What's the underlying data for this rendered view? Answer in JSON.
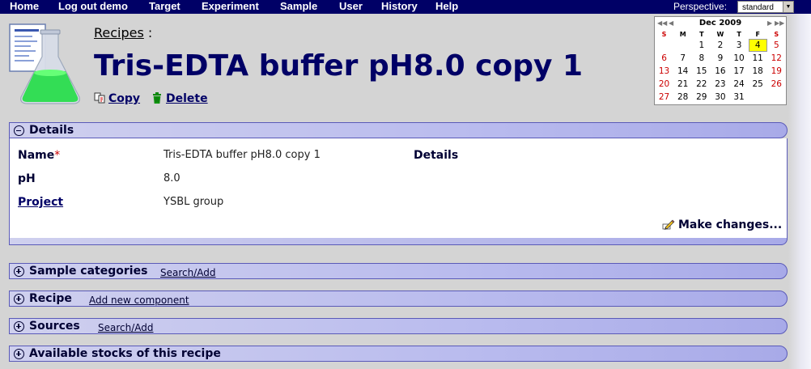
{
  "nav": {
    "items": [
      "Home",
      "Log out demo",
      "Target",
      "Experiment",
      "Sample",
      "User",
      "History",
      "Help"
    ],
    "perspective_label": "Perspective:",
    "perspective_value": "standard"
  },
  "header": {
    "breadcrumb": "Recipes",
    "breadcrumb_sep": ":",
    "title": "Tris-EDTA buffer pH8.0 copy 1",
    "copy_label": "Copy",
    "delete_label": "Delete"
  },
  "calendar": {
    "prev_year": "◀◀",
    "prev_month": "◀",
    "next_month": "▶",
    "next_year": "▶▶",
    "month": "Dec 2009",
    "dow": [
      "S",
      "M",
      "T",
      "W",
      "T",
      "F",
      "S"
    ],
    "weeks": [
      [
        "",
        "",
        "1",
        "2",
        "3",
        "4",
        "5"
      ],
      [
        "6",
        "7",
        "8",
        "9",
        "10",
        "11",
        "12"
      ],
      [
        "13",
        "14",
        "15",
        "16",
        "17",
        "18",
        "19"
      ],
      [
        "20",
        "21",
        "22",
        "23",
        "24",
        "25",
        "26"
      ],
      [
        "27",
        "28",
        "29",
        "30",
        "31",
        "",
        ""
      ]
    ],
    "today": "4"
  },
  "details": {
    "title": "Details",
    "name_label": "Name",
    "required_mark": "*",
    "name_value": "Tris-EDTA buffer pH8.0 copy 1",
    "ph_label": "pH",
    "ph_value": "8.0",
    "project_label": "Project",
    "project_value": "YSBL group",
    "details_label": "Details",
    "make_changes": "Make changes..."
  },
  "sections": [
    {
      "title": "Sample categories",
      "link": "Search/Add"
    },
    {
      "title": "Recipe",
      "link": "Add new component"
    },
    {
      "title": "Sources",
      "link": "Search/Add"
    },
    {
      "title": "Available stocks of this recipe",
      "link": ""
    }
  ],
  "colors": {
    "nav_bg": "#000066",
    "title": "#000066",
    "section_bg": "#b9bbee",
    "today_highlight": "#ffff00",
    "weekend": "#cc0000"
  }
}
